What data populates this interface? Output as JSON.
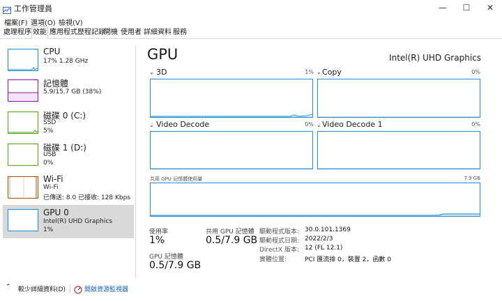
{
  "window": {
    "title": "工作管理員",
    "minimize": "—",
    "maximize": "☐",
    "close": "✕"
  },
  "menu": [
    "檔案(F)",
    "選項(O)",
    "檢視(V)"
  ],
  "tabs": [
    "處理程序",
    "效能",
    "應用程式歷程記錄",
    "開機",
    "使用者",
    "詳細資料",
    "服務"
  ],
  "selected_tab": 1,
  "resources": [
    {
      "name": "CPU",
      "sub1": "17% 1.28 GHz",
      "sub2": "",
      "sub3": "",
      "color": "#1190d3"
    },
    {
      "name": "記憶體",
      "sub1": "5.9/15.7 GB (38%)",
      "sub2": "",
      "sub3": "",
      "color": "#8b12ae"
    },
    {
      "name": "磁碟 0 (C:)",
      "sub1": "SSD",
      "sub2": "5%",
      "sub3": "",
      "color": "#4da60c"
    },
    {
      "name": "磁碟 1 (D:)",
      "sub1": "USB",
      "sub2": "0%",
      "sub3": "",
      "color": "#4da60c"
    },
    {
      "name": "Wi-Fi",
      "sub1": "Wi-Fi",
      "sub2": "已傳送: 8.0  已接收: 128 Kbps",
      "sub3": "",
      "color": "#a74f01"
    },
    {
      "name": "GPU 0",
      "sub1": "Intel(R) UHD Graphics",
      "sub2": "1%",
      "sub3": "",
      "color": "#1190d3"
    }
  ],
  "main": {
    "title": "GPU",
    "model": "Intel(R) UHD Graphics",
    "engines": [
      {
        "label": "3D",
        "pct": "1%"
      },
      {
        "label": "Copy",
        "pct": "0%"
      },
      {
        "label": "Video Decode",
        "pct": "0%"
      },
      {
        "label": "Video Decode 1",
        "pct": "0%"
      }
    ],
    "shared_graph": {
      "label": "共用 GPU 記憶體使用量",
      "max": "7.9 GB"
    },
    "stats": {
      "utilization_label": "使用率",
      "utilization": "1%",
      "shared_mem_label": "共用 GPU 記憶體",
      "shared_mem": "0.5/7.9 GB",
      "gpu_mem_label": "GPU 記憶體",
      "gpu_mem": "0.5/7.9 GB"
    },
    "props": [
      {
        "key": "驅動程式版本:",
        "value": "30.0.101.1369"
      },
      {
        "key": "驅動程式日期:",
        "value": "2022/2/3"
      },
      {
        "key": "DirectX 版本:",
        "value": "12 (FL 12.1)"
      },
      {
        "key": "實體位置:",
        "value": "PCI 匯流排 0，裝置 2，函數 0"
      }
    ]
  },
  "footer": {
    "fewer_details": "較少詳細資料(D)",
    "resource_monitor": "開啟資源監視器"
  },
  "icons": [
    "task-manager-icon",
    "chevron-down-icon",
    "chevron-up-icon",
    "resource-monitor-icon"
  ]
}
